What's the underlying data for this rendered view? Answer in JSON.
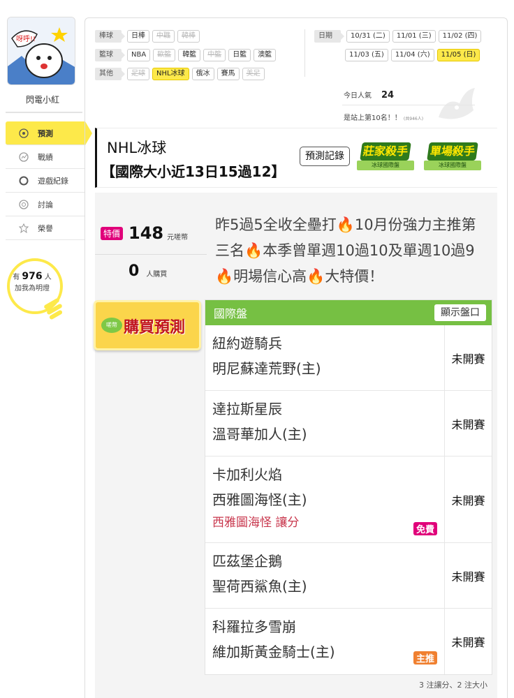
{
  "sidebar": {
    "username": "閃電小紅",
    "avatar_text": "呀呼!!",
    "nav": [
      {
        "label": "預測",
        "icon": "target-icon",
        "active": true
      },
      {
        "label": "戰績",
        "icon": "chart-icon"
      },
      {
        "label": "遊戲紀錄",
        "icon": "circle-icon"
      },
      {
        "label": "討論",
        "icon": "chat-icon"
      },
      {
        "label": "榮譽",
        "icon": "medal-icon"
      }
    ],
    "lamp": {
      "prefix": "有",
      "count": "976",
      "suffix": "人",
      "line2": "加我為明燈"
    }
  },
  "filters": {
    "baseball": {
      "label": "棒球",
      "chips": [
        "日棒",
        "中職",
        "韓棒"
      ]
    },
    "basketball": {
      "label": "籃球",
      "chips": [
        "NBA",
        "歐籃",
        "韓籃",
        "中籃",
        "日籃",
        "澳籃"
      ]
    },
    "other": {
      "label": "其他",
      "chips": [
        "足球",
        "NHL冰球",
        "俄冰",
        "賽馬",
        "美足"
      ]
    }
  },
  "dates": {
    "label": "日期",
    "items": [
      "10/31 (二)",
      "11/01 (三)",
      "11/02 (四)",
      "11/03 (五)",
      "11/04 (六)",
      "11/05 (日)"
    ]
  },
  "stats": {
    "popularity_label": "今日人氣",
    "popularity_value": "24",
    "rank_text": "是站上第10名！！",
    "rank_total": "(共946人)"
  },
  "header": {
    "title": "NHL冰球",
    "subtitle": "【國際大小近13日15過12】",
    "record_button": "預測記錄",
    "badge1_title": "莊家殺手",
    "badge1_sub": "冰球國際盤",
    "badge2_title": "單場殺手",
    "badge2_sub": "冰球國際盤"
  },
  "offer": {
    "tag": "特價",
    "price": "148",
    "price_unit": "元嗟幣",
    "buyers": "0",
    "buyers_unit": "人購買",
    "description": "昨5過5全收全壘打🔥10月份強力主推第三名🔥本季曾單週10過10及單週10過9🔥明場信心高🔥大特價！",
    "buy_button": "購買預測",
    "coin_text": "嗟幣"
  },
  "table": {
    "title": "國際盤",
    "toggle_button": "顯示盤口",
    "games": [
      {
        "away": "紐約遊騎兵",
        "home": "明尼蘇達荒野(主)",
        "status": "未開賽"
      },
      {
        "away": "達拉斯星辰",
        "home": "溫哥華加人(主)",
        "status": "未開賽"
      },
      {
        "away": "卡加利火焰",
        "home": "西雅圖海怪(主)",
        "status": "未開賽",
        "pick": "西雅圖海怪 讓分",
        "pick_tag": "免費"
      },
      {
        "away": "匹茲堡企鵝",
        "home": "聖荷西鯊魚(主)",
        "status": "未開賽"
      },
      {
        "away": "科羅拉多雪崩",
        "home": "維加斯黃金騎士(主)",
        "status": "未開賽",
        "pick_tag": "主推"
      }
    ],
    "footer": "3 注讓分、2 注大小"
  },
  "colors": {
    "accent_yellow": "#fde94a",
    "green": "#76c043",
    "magenta": "#e0007a",
    "orange": "#f08030"
  }
}
